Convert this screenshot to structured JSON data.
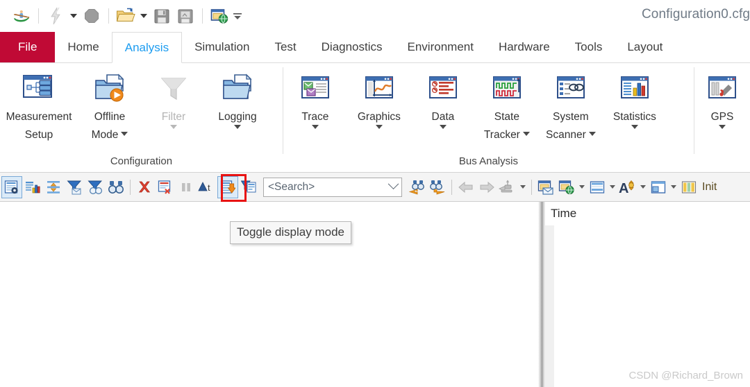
{
  "window": {
    "title": "Configuration0.cfg"
  },
  "quick_access": {
    "items": [
      {
        "name": "canoe-kayak-logo-icon",
        "label": "CANoe"
      },
      {
        "name": "separator-1",
        "label": ""
      },
      {
        "name": "lightning-icon",
        "label": "Start Measurement"
      },
      {
        "name": "lightning-dropdown-icon",
        "label": "Start Options"
      },
      {
        "name": "stop-octagon-icon",
        "label": "Stop Measurement"
      },
      {
        "name": "separator-2",
        "label": ""
      },
      {
        "name": "open-folder-icon",
        "label": "Open Configuration"
      },
      {
        "name": "open-dropdown-icon",
        "label": "Recent Configurations"
      },
      {
        "name": "save-icon",
        "label": "Save"
      },
      {
        "name": "save-as-icon",
        "label": "Save As"
      },
      {
        "name": "separator-3",
        "label": ""
      },
      {
        "name": "globe-window-icon",
        "label": "Online/Offline"
      },
      {
        "name": "customize-qat-icon",
        "label": "Customize Quick Access Toolbar"
      }
    ]
  },
  "tabs": {
    "items": [
      {
        "label": "File",
        "name": "tab-file",
        "state": "file"
      },
      {
        "label": "Home",
        "name": "tab-home",
        "state": "normal"
      },
      {
        "label": "Analysis",
        "name": "tab-analysis",
        "state": "active"
      },
      {
        "label": "Simulation",
        "name": "tab-simulation",
        "state": "normal"
      },
      {
        "label": "Test",
        "name": "tab-test",
        "state": "normal"
      },
      {
        "label": "Diagnostics",
        "name": "tab-diagnostics",
        "state": "normal"
      },
      {
        "label": "Environment",
        "name": "tab-environment",
        "state": "normal"
      },
      {
        "label": "Hardware",
        "name": "tab-hardware",
        "state": "normal"
      },
      {
        "label": "Tools",
        "name": "tab-tools",
        "state": "normal"
      },
      {
        "label": "Layout",
        "name": "tab-layout",
        "state": "normal"
      }
    ]
  },
  "ribbon": {
    "groups": [
      {
        "label": "Configuration",
        "name": "ribbon-group-configuration",
        "buttons": [
          {
            "label_line1": "Measurement",
            "label_line2": "Setup",
            "icon": "measurement-setup-icon",
            "dropdown": false,
            "disabled": false
          },
          {
            "label_line1": "Offline",
            "label_line2": "Mode",
            "icon": "offline-mode-icon",
            "dropdown": true,
            "disabled": false
          },
          {
            "label_line1": "Filter",
            "label_line2": "",
            "icon": "filter-funnel-icon",
            "dropdown": true,
            "disabled": true
          },
          {
            "label_line1": "Logging",
            "label_line2": "",
            "icon": "logging-icon",
            "dropdown": true,
            "disabled": false
          }
        ]
      },
      {
        "label": "Bus Analysis",
        "name": "ribbon-group-bus-analysis",
        "buttons": [
          {
            "label_line1": "Trace",
            "label_line2": "",
            "icon": "trace-window-icon",
            "dropdown": true,
            "disabled": false
          },
          {
            "label_line1": "Graphics",
            "label_line2": "",
            "icon": "graphics-window-icon",
            "dropdown": true,
            "disabled": false
          },
          {
            "label_line1": "Data",
            "label_line2": "",
            "icon": "data-window-icon",
            "dropdown": true,
            "disabled": false
          },
          {
            "label_line1": "State",
            "label_line2": "Tracker",
            "icon": "state-tracker-icon",
            "dropdown": true,
            "disabled": false
          },
          {
            "label_line1": "System",
            "label_line2": "Scanner",
            "icon": "system-scanner-icon",
            "dropdown": true,
            "disabled": false
          },
          {
            "label_line1": "Statistics",
            "label_line2": "",
            "icon": "statistics-icon",
            "dropdown": true,
            "disabled": false
          }
        ]
      },
      {
        "label": "",
        "name": "ribbon-group-gps",
        "buttons": [
          {
            "label_line1": "GPS",
            "label_line2": "",
            "icon": "gps-window-icon",
            "dropdown": true,
            "disabled": false
          }
        ]
      }
    ]
  },
  "toolbar": {
    "buttons": [
      {
        "name": "toggle-column-settings-button",
        "icon": "list-gear-icon",
        "selected": true,
        "dropdown": false
      },
      {
        "name": "statistics-view-button",
        "icon": "list-chart-icon",
        "selected": false,
        "dropdown": false
      },
      {
        "name": "expand-collapse-button",
        "icon": "expand-vertical-icon",
        "selected": false,
        "dropdown": false
      },
      {
        "name": "filter-messages-button",
        "icon": "funnel-mail-icon",
        "selected": false,
        "dropdown": false
      },
      {
        "name": "filter-stop-button",
        "icon": "funnel-stop-icon",
        "selected": false,
        "dropdown": false
      },
      {
        "name": "find-button",
        "icon": "binoculars-icon",
        "selected": false,
        "dropdown": false
      },
      {
        "name": "separator-1",
        "icon": "separator",
        "selected": false,
        "dropdown": false
      },
      {
        "name": "clear-button",
        "icon": "red-x-icon",
        "selected": false,
        "dropdown": false
      },
      {
        "name": "clear-window-button",
        "icon": "list-delete-icon",
        "selected": false,
        "dropdown": false
      },
      {
        "name": "pause-button",
        "icon": "pause-icon",
        "selected": false,
        "dropdown": false
      },
      {
        "name": "trigger-button",
        "icon": "triangle-t-icon",
        "selected": false,
        "dropdown": false
      },
      {
        "name": "toggle-display-mode-button",
        "icon": "list-down-arrow-icon",
        "selected": true,
        "dropdown": false
      },
      {
        "name": "analysis-filter-button",
        "icon": "funnel-list-icon",
        "selected": false,
        "dropdown": false
      }
    ],
    "search": {
      "value": "<Search>",
      "placeholder": "<Search>",
      "name": "search-input"
    },
    "buttons_right": [
      {
        "name": "find-previous-button",
        "icon": "binoculars-left-icon",
        "dropdown": false
      },
      {
        "name": "find-next-button",
        "icon": "binoculars-right-icon",
        "dropdown": false
      },
      {
        "name": "separator-2",
        "icon": "separator",
        "dropdown": false
      },
      {
        "name": "navigate-back-button",
        "icon": "arrow-left-icon",
        "dropdown": false
      },
      {
        "name": "navigate-forward-button",
        "icon": "arrow-right-icon",
        "dropdown": false
      },
      {
        "name": "marker-button",
        "icon": "marker-icon",
        "dropdown": true
      },
      {
        "name": "separator-3",
        "icon": "separator",
        "dropdown": false
      },
      {
        "name": "export-mail-button",
        "icon": "window-mail-icon",
        "dropdown": false
      },
      {
        "name": "export-web-button",
        "icon": "window-globe-icon",
        "dropdown": true
      },
      {
        "name": "layout-rows-button",
        "icon": "rows-layout-icon",
        "dropdown": true
      },
      {
        "name": "font-settings-button",
        "icon": "font-a-icon",
        "dropdown": true
      },
      {
        "name": "window-layout-button",
        "icon": "window-split-icon",
        "dropdown": true
      },
      {
        "name": "columns-button",
        "icon": "columns-color-icon",
        "dropdown": false
      }
    ],
    "trailing_label": "Init",
    "trailing_label_partial": "Init"
  },
  "tooltip": {
    "text": "Toggle display mode",
    "name": "toggle-display-mode-tooltip"
  },
  "panes": {
    "right": {
      "column_header": "Time"
    }
  },
  "watermark": {
    "text": "CSDN @Richard_Brown"
  },
  "colors": {
    "file_tab": "#c00a35",
    "active_tab_text": "#1c9cf0",
    "highlight_box": "#e81313",
    "selected_button_border": "#7aa9d6",
    "selected_button_fill": "#dcebf8",
    "title_text": "#6f7a86"
  }
}
